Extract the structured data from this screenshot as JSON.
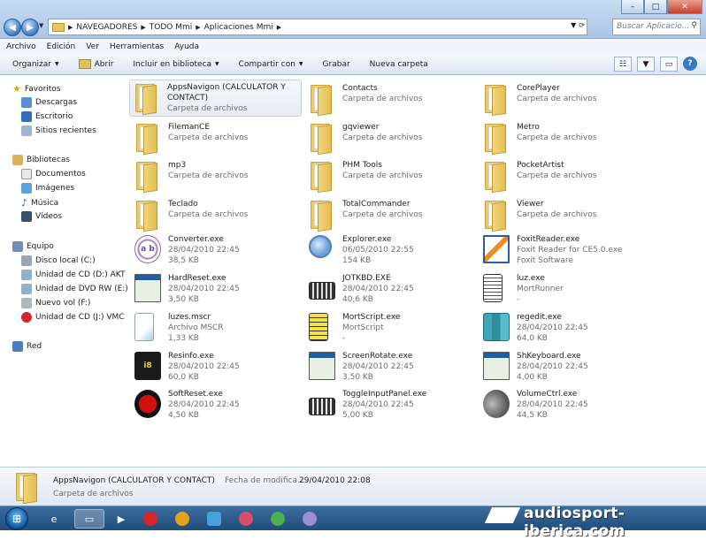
{
  "window": {
    "controls": [
      "–",
      "□",
      "✕"
    ]
  },
  "address": {
    "crumbs": [
      "NAVEGADORES",
      "TODO Mmi",
      "Aplicaciones Mmi"
    ],
    "search_placeholder": "Buscar Aplicacio..."
  },
  "menubar": {
    "items": [
      "Archivo",
      "Edición",
      "Ver",
      "Herramientas",
      "Ayuda"
    ]
  },
  "cmdbar": {
    "organize": "Organizar",
    "open": "Abrir",
    "include": "Incluir en biblioteca",
    "share": "Compartir con",
    "burn": "Grabar",
    "new_folder": "Nueva carpeta"
  },
  "nav": {
    "favorites": "Favoritos",
    "downloads": "Descargas",
    "desktop": "Escritorio",
    "recent": "Sitios recientes",
    "libraries": "Bibliotecas",
    "documents": "Documentos",
    "images": "Imágenes",
    "music": "Música",
    "videos": "Vídeos",
    "computer": "Equipo",
    "local_disk": "Disco local (C:)",
    "cd_d": "Unidad de CD (D:) AKT",
    "dvd_e": "Unidad de DVD RW (E:)",
    "new_vol": "Nuevo vol (F:)",
    "cd_j": "Unidad de CD (J:) VMC",
    "network": "Red"
  },
  "files": [
    {
      "name": "AppsNavigon (CALCULATOR Y",
      "name2": "CONTACT)",
      "l2": "Carpeta de archivos",
      "l3": "",
      "icon": "folder"
    },
    {
      "name": "Contacts",
      "l2": "Carpeta de archivos",
      "l3": "",
      "icon": "folder"
    },
    {
      "name": "CorePlayer",
      "l2": "Carpeta de archivos",
      "l3": "",
      "icon": "folder"
    },
    {
      "name": "FilemanCE",
      "l2": "Carpeta de archivos",
      "l3": "",
      "icon": "folder"
    },
    {
      "name": "gqviewer",
      "l2": "Carpeta de archivos",
      "l3": "",
      "icon": "folder"
    },
    {
      "name": "Metro",
      "l2": "Carpeta de archivos",
      "l3": "",
      "icon": "folder"
    },
    {
      "name": "mp3",
      "l2": "Carpeta de archivos",
      "l3": "",
      "icon": "folder"
    },
    {
      "name": "PHM Tools",
      "l2": "Carpeta de archivos",
      "l3": "",
      "icon": "folder"
    },
    {
      "name": "PocketArtist",
      "l2": "Carpeta de archivos",
      "l3": "",
      "icon": "folder"
    },
    {
      "name": "Teclado",
      "l2": "Carpeta de archivos",
      "l3": "",
      "icon": "folder"
    },
    {
      "name": "TotalCommander",
      "l2": "Carpeta de archivos",
      "l3": "",
      "icon": "folder"
    },
    {
      "name": "Viewer",
      "l2": "Carpeta de archivos",
      "l3": "",
      "icon": "folder"
    },
    {
      "name": "Converter.exe",
      "l2": "28/04/2010 22:45",
      "l3": "38,5 KB",
      "icon": "converter"
    },
    {
      "name": "Explorer.exe",
      "l2": "06/05/2010 22:55",
      "l3": "154 KB",
      "icon": "explorer"
    },
    {
      "name": "FoxitReader.exe",
      "l2": "Foxit Reader for CE5.0.exe",
      "l3": "Foxit Software",
      "icon": "foxit"
    },
    {
      "name": "HardReset.exe",
      "l2": "28/04/2010 22:45",
      "l3": "3,50 KB",
      "icon": "window"
    },
    {
      "name": "JOTKBD.EXE",
      "l2": "28/04/2010 22:45",
      "l3": "40,6 KB",
      "icon": "keyboard"
    },
    {
      "name": "luz.exe",
      "l2": "MortRunner",
      "l3": "-",
      "icon": "script"
    },
    {
      "name": "luzes.mscr",
      "l2": "Archivo MSCR",
      "l3": "1,33 KB",
      "icon": "mscr"
    },
    {
      "name": "MortScript.exe",
      "l2": "MortScript",
      "l3": "-",
      "icon": "mortscript"
    },
    {
      "name": "regedit.exe",
      "l2": "28/04/2010 22:45",
      "l3": "64,0 KB",
      "icon": "regedit"
    },
    {
      "name": "Resinfo.exe",
      "l2": "28/04/2010 22:45",
      "l3": "60,0 KB",
      "icon": "resinfo"
    },
    {
      "name": "ScreenRotate.exe",
      "l2": "28/04/2010 22:45",
      "l3": "3,50 KB",
      "icon": "window"
    },
    {
      "name": "ShKeyboard.exe",
      "l2": "28/04/2010 22:45",
      "l3": "4,00 KB",
      "icon": "window"
    },
    {
      "name": "SoftReset.exe",
      "l2": "28/04/2010 22:45",
      "l3": "4,50 KB",
      "icon": "softreset"
    },
    {
      "name": "ToggleInputPanel.exe",
      "l2": "28/04/2010 22:45",
      "l3": "5,00 KB",
      "icon": "keyboard"
    },
    {
      "name": "VolumeCtrl.exe",
      "l2": "28/04/2010 22:45",
      "l3": "44,5 KB",
      "icon": "volume"
    }
  ],
  "details": {
    "name": "AppsNavigon (CALCULATOR Y CONTACT)",
    "label": "Fecha de modifica...",
    "value": "29/04/2010 22:08",
    "type": "Carpeta de archivos"
  },
  "watermark": "audiosport-iberica.com"
}
